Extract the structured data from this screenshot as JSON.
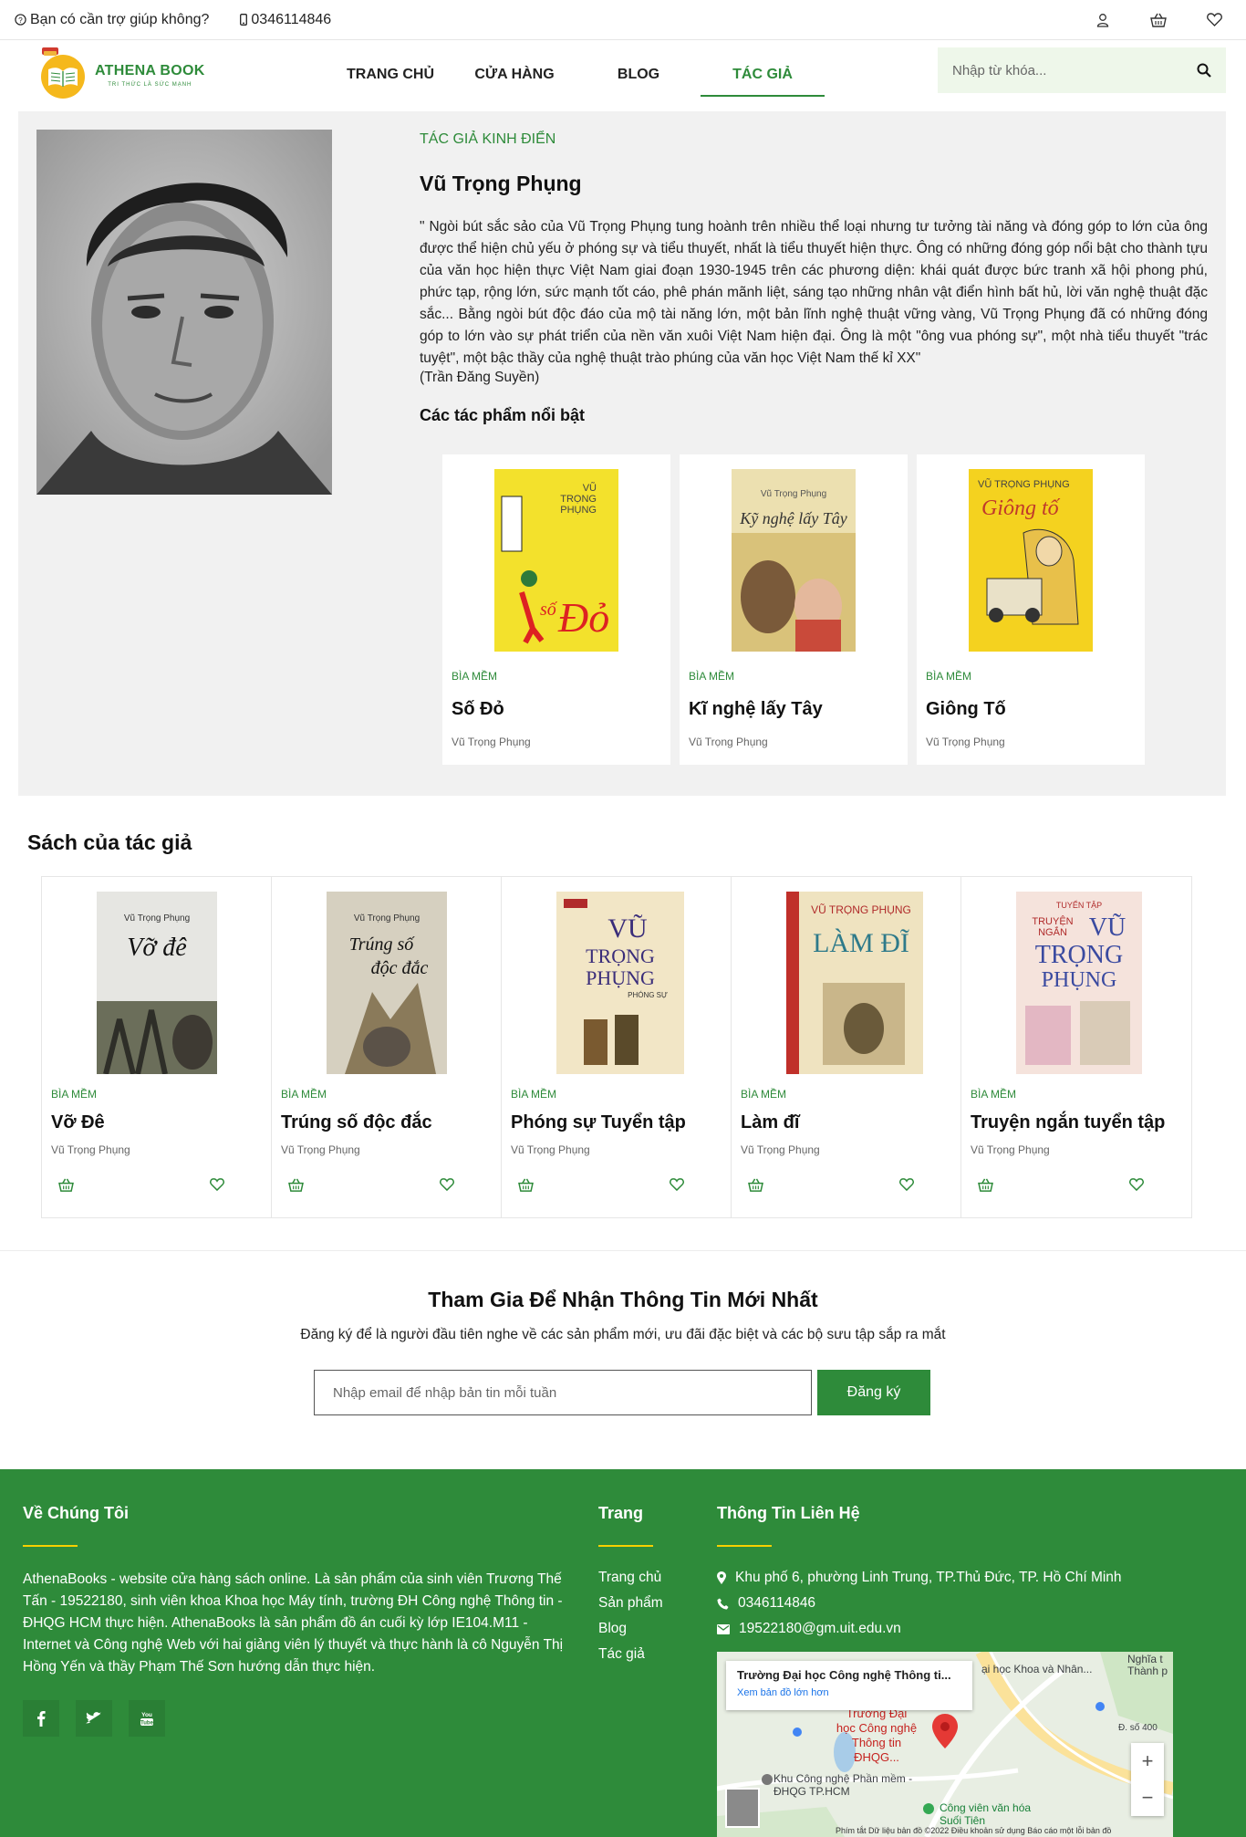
{
  "topbar": {
    "help": "Bạn có cần trợ giúp không?",
    "phone": "0346114846"
  },
  "header": {
    "logo_name": "ATHENA BOOK",
    "logo_tagline": "TRI THỨC LÀ SỨC MẠNH",
    "nav": [
      {
        "label": "TRANG CHỦ"
      },
      {
        "label": "CỬA HÀNG"
      },
      {
        "label": "BLOG"
      },
      {
        "label": "TÁC GIẢ"
      }
    ],
    "search_placeholder": "Nhập từ khóa..."
  },
  "author": {
    "kicker": "TÁC GIẢ KINH ĐIỂN",
    "name": "Vũ Trọng Phụng",
    "bio": "\" Ngòi bút sắc sảo của Vũ Trọng Phụng tung hoành trên nhiều thể loại nhưng tư tưởng tài năng và đóng góp to lớn của ông được thể hiện chủ yếu ở phóng sự và tiểu thuyết, nhất là tiểu thuyết hiện thực. Ông có những đóng góp nổi bật cho thành tựu của văn học hiện thực Việt Nam giai đoạn 1930-1945 trên các phương diện: khái quát được bức tranh xã hội phong phú, phức tạp, rộng lớn, sức mạnh tốt cáo, phê phán mãnh liệt, sáng tạo những nhân vật điển hình bất hủ, lời văn nghệ thuật đặc sắc... Bằng ngòi bút độc đáo của mộ tài năng lớn, một bản lĩnh nghệ thuật vững vàng, Vũ Trọng Phụng đã có những đóng góp to lớn vào sự phát triển của nền văn xuôi Việt Nam hiện đại. Ông là một \"ông vua phóng sự\", một nhà tiểu thuyết \"trác tuyệt\", một bậc thầy của nghệ thuật trào phúng của văn học Việt Nam thế kỉ XX\"",
    "credit": "(Trần Đăng Suyền)",
    "featured_title": "Các tác phẩm nổi bật",
    "featured": [
      {
        "kind": "BÌA MỀM",
        "title": "Số Đỏ",
        "author": "Vũ Trọng Phụng",
        "cover_color": "#f3e12c"
      },
      {
        "kind": "BÌA MỀM",
        "title": "Kĩ nghệ lấy Tây",
        "author": "Vũ Trọng Phụng",
        "cover_color": "#d9c27a"
      },
      {
        "kind": "BÌA MỀM",
        "title": "Giông Tố",
        "author": "Vũ Trọng Phụng",
        "cover_color": "#f4d21f"
      }
    ]
  },
  "books_section": {
    "heading": "Sách của tác giả",
    "books": [
      {
        "kind": "BÌA MỀM",
        "title": "Vỡ Đê",
        "author": "Vũ Trọng Phụng",
        "cover_color": "#d8d8d4"
      },
      {
        "kind": "BÌA MỀM",
        "title": "Trúng số độc đắc",
        "author": "Vũ Trọng Phụng",
        "cover_color": "#c9c3b5"
      },
      {
        "kind": "BÌA MỀM",
        "title": "Phóng sự Tuyển tập",
        "author": "Vũ Trọng Phụng",
        "cover_color": "#f2e6c6"
      },
      {
        "kind": "BÌA MỀM",
        "title": "Làm đĩ",
        "author": "Vũ Trọng Phụng",
        "cover_color": "#efe3c0"
      },
      {
        "kind": "BÌA MỀM",
        "title": "Truyện ngắn tuyển tập",
        "author": "Vũ Trọng Phụng",
        "cover_color": "#f5e3dc"
      }
    ]
  },
  "newsletter": {
    "title": "Tham Gia Để Nhận Thông Tin Mới Nhất",
    "subtitle": "Đăng ký để là người đầu tiên nghe về các sản phẩm mới, ưu đãi đặc biệt và các bộ sưu tập sắp ra mắt",
    "placeholder": "Nhập email để nhập bản tin mỗi tuần",
    "button": "Đăng ký"
  },
  "footer": {
    "about_title": "Về Chúng Tôi",
    "about_text": "AthenaBooks - website cửa hàng sách online. Là sản phẩm của sinh viên Trương Thế Tấn - 19522180, sinh viên khoa Khoa học Máy tính, trường ĐH Công nghệ Thông tin - ĐHQG HCM thực hiện. AthenaBooks là sản phẩm đồ án cuối kỳ lớp IE104.M11 - Internet và Công nghệ Web với hai giảng viên lý thuyết và thực hành là cô Nguyễn Thị Hồng Yến và thầy Phạm Thế Sơn hướng dẫn thực hiện.",
    "pages_title": "Trang",
    "pages": [
      "Trang chủ",
      "Sản phẩm",
      "Blog",
      "Tác giả"
    ],
    "contact_title": "Thông Tin Liên Hệ",
    "contact": {
      "address": "Khu phố 6, phường Linh Trung, TP.Thủ Đức, TP. Hồ Chí Minh",
      "phone": "0346114846",
      "email": "19522180@gm.uit.edu.vn"
    },
    "map": {
      "card_title": "Trường Đại học Công nghệ Thông ti...",
      "card_link": "Xem bản đồ lớn hơn",
      "pin_label": "Trường Đại học Công nghệ Thông tin ĐHQG...",
      "label_1": "Khu Công nghệ Phần mềm - ĐHQG TP.HCM",
      "label_2": "Công viên văn hóa Suối Tiên",
      "label_3": "ại học Khoa và Nhân...",
      "label_4": "Nghĩa t Thành p",
      "label_5": "Đ. số 400",
      "footer": "Phím tắt   Dữ liệu bản đồ ©2022   Điều khoản sử dụng   Báo cáo một lỗi bản đồ"
    }
  }
}
